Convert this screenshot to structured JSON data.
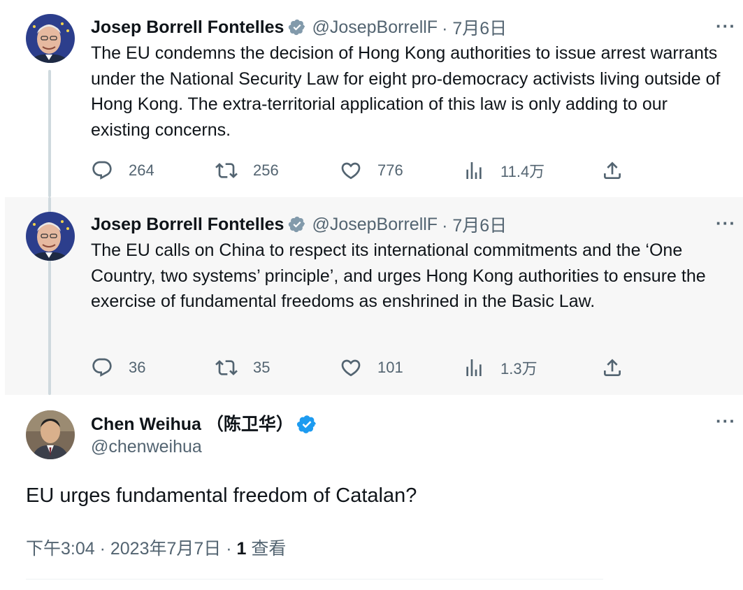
{
  "colors": {
    "verified_gray": "#829aab",
    "verified_blue": "#1d9bf0",
    "secondary_text": "#536471",
    "thread_line": "#cfd9de"
  },
  "tweets": [
    {
      "author": "Josep Borrell Fontelles",
      "handle": "@JosepBorrellF",
      "date": "· 7月6日",
      "more": "···",
      "verified": "gray-badge-icon",
      "text": "The EU condemns the decision of Hong Kong authorities to issue arrest warrants under the National Security Law for eight pro-democracy activists living outside of Hong Kong. The extra-territorial application of this law is only adding to our existing concerns.",
      "replies": "264",
      "retweets": "256",
      "likes": "776",
      "views": "11.4万"
    },
    {
      "author": "Josep Borrell Fontelles",
      "handle": "@JosepBorrellF",
      "date": "· 7月6日",
      "more": "···",
      "verified": "gray-badge-icon",
      "text": "The EU calls on China to respect its international commitments and the ‘One Country, two systems’ principle’, and urges Hong Kong authorities to ensure the exercise of fundamental freedoms as enshrined in the Basic Law.",
      "replies": "36",
      "retweets": "35",
      "likes": "101",
      "views": "1.3万"
    }
  ],
  "main_tweet": {
    "author": "Chen Weihua （陈卫华）",
    "handle": "@chenweihua",
    "more": "···",
    "verified": "blue-badge-icon",
    "text": "EU urges fundamental freedom of Catalan?",
    "time": "下午3:04 · 2023年7月7日 · ",
    "views_count": "1",
    "views_label": " 查看"
  }
}
